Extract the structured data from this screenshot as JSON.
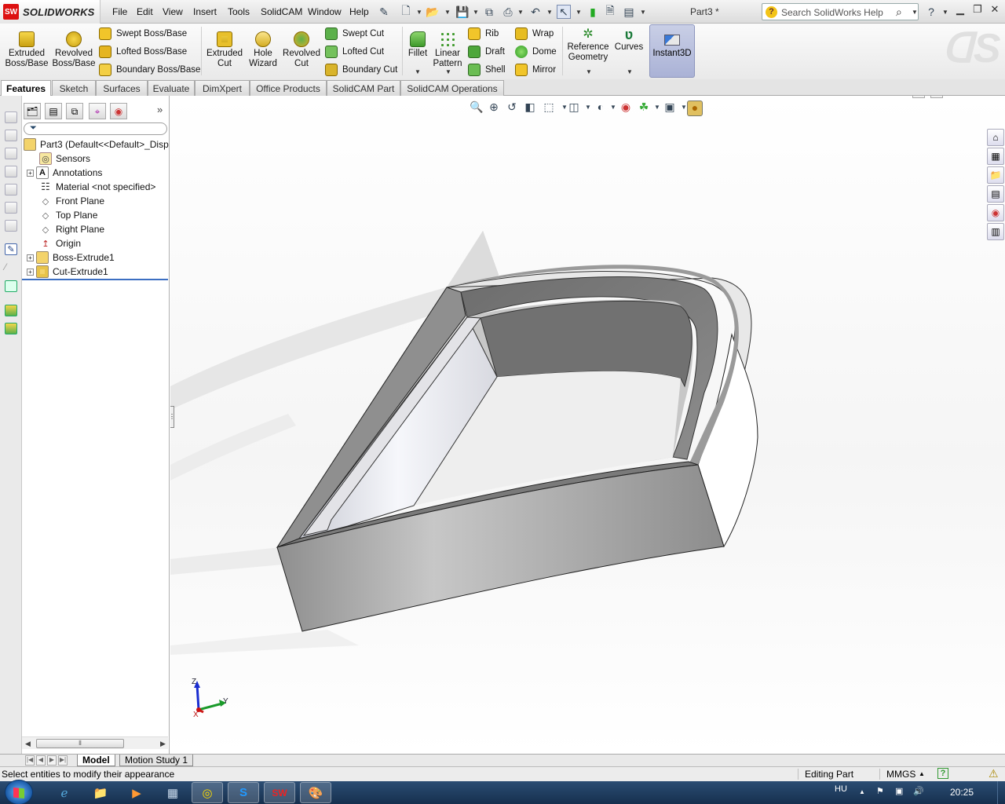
{
  "menubar": {
    "app_name": "SOLIDWORKS",
    "menus": [
      "File",
      "Edit",
      "View",
      "Insert",
      "Tools",
      "SolidCAM",
      "Window",
      "Help"
    ],
    "document_title": "Part3 *",
    "search_placeholder": "Search SolidWorks Help"
  },
  "commands": {
    "extruded_boss": "Extruded\nBoss/Base",
    "revolved_boss": "Revolved\nBoss/Base",
    "swept_boss": "Swept Boss/Base",
    "lofted_boss": "Lofted Boss/Base",
    "boundary_boss": "Boundary Boss/Base",
    "extruded_cut": "Extruded\nCut",
    "hole_wizard": "Hole\nWizard",
    "revolved_cut": "Revolved\nCut",
    "swept_cut": "Swept Cut",
    "lofted_cut": "Lofted Cut",
    "boundary_cut": "Boundary Cut",
    "fillet": "Fillet",
    "linear_pattern": "Linear\nPattern",
    "rib": "Rib",
    "draft": "Draft",
    "shell": "Shell",
    "wrap": "Wrap",
    "dome": "Dome",
    "mirror": "Mirror",
    "reference_geometry": "Reference\nGeometry",
    "curves": "Curves",
    "instant3d": "Instant3D"
  },
  "tabs": [
    "Features",
    "Sketch",
    "Surfaces",
    "Evaluate",
    "DimXpert",
    "Office Products",
    "SolidCAM Part",
    "SolidCAM Operations"
  ],
  "active_tab": "Features",
  "tree": {
    "root": "Part3  (Default<<Default>_Disp",
    "items": [
      {
        "label": "Sensors",
        "icon": "sensor-icon"
      },
      {
        "label": "Annotations",
        "icon": "annotations-icon"
      },
      {
        "label": "Material <not specified>",
        "icon": "material-icon"
      },
      {
        "label": "Front Plane",
        "icon": "plane-icon"
      },
      {
        "label": "Top Plane",
        "icon": "plane-icon"
      },
      {
        "label": "Right Plane",
        "icon": "plane-icon"
      },
      {
        "label": "Origin",
        "icon": "origin-icon"
      },
      {
        "label": "Boss-Extrude1",
        "icon": "extrude-icon"
      },
      {
        "label": "Cut-Extrude1",
        "icon": "cut-extrude-icon"
      }
    ]
  },
  "triad": {
    "z": "Z",
    "y": "Y",
    "x": "X"
  },
  "bottom_tabs": [
    "Model",
    "Motion Study 1"
  ],
  "status": {
    "message": "Select entities to modify their appearance",
    "mode": "Editing Part",
    "units": "MMGS"
  },
  "taskbar": {
    "language": "HU",
    "time": "20:25"
  },
  "colors": {
    "accent_blue": "#3c6fc2",
    "instant3d_active": "#b0b8da",
    "taskbar": "#1d3b60"
  }
}
